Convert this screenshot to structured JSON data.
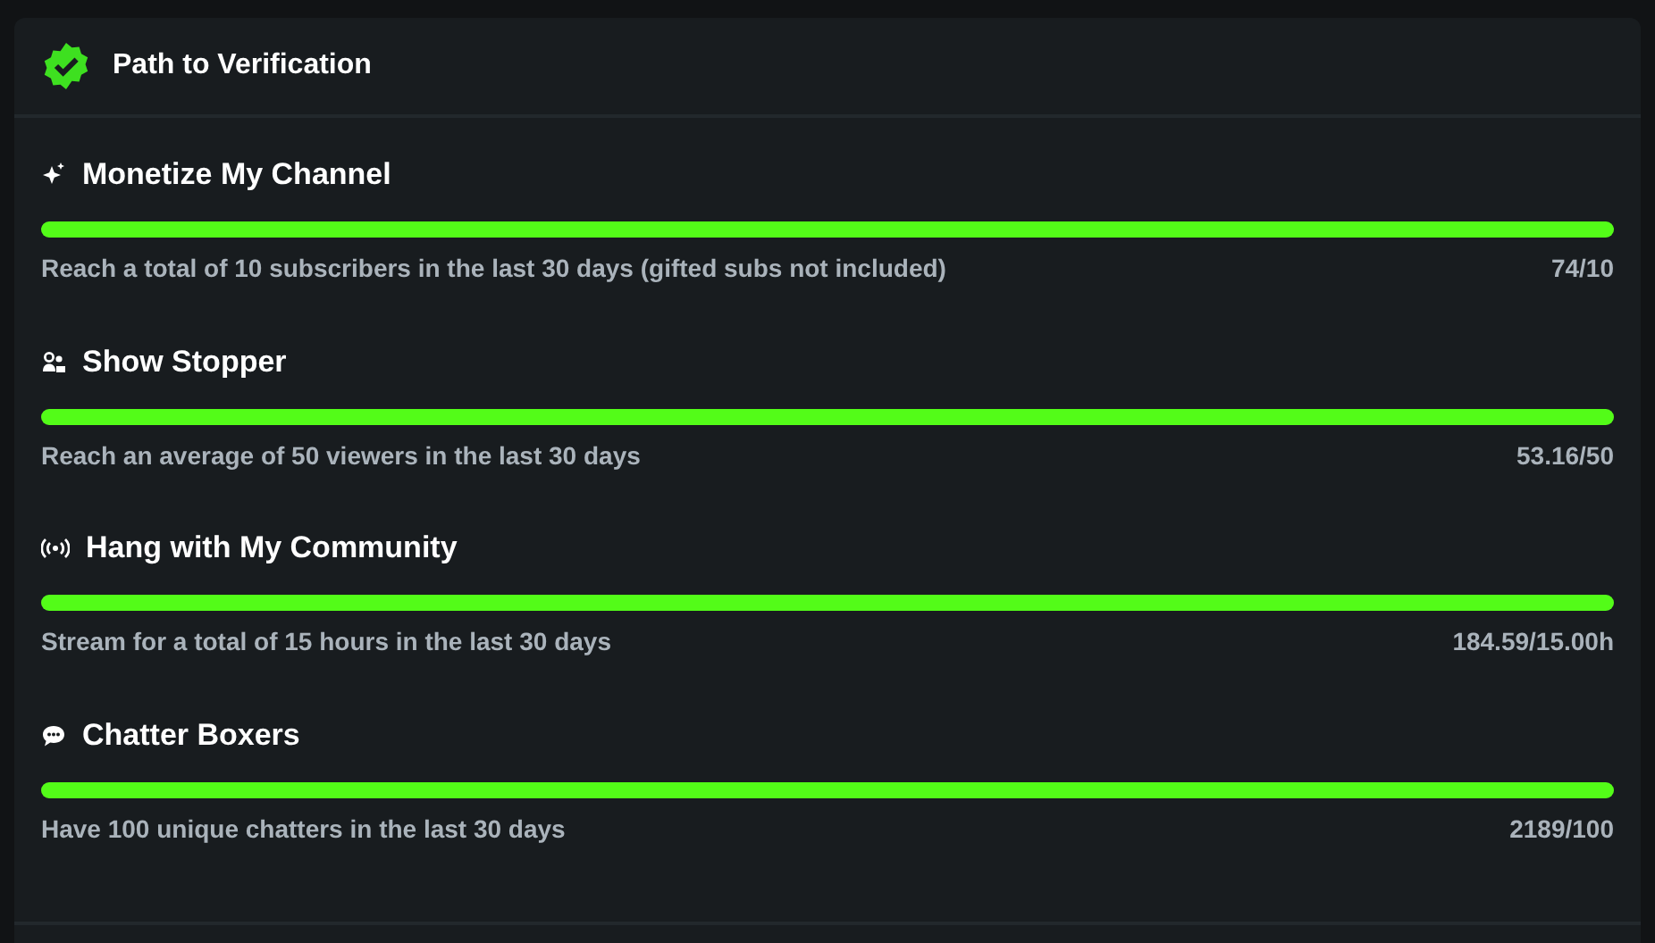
{
  "header": {
    "title": "Path to Verification"
  },
  "goals": [
    {
      "kind": "sparkle",
      "title": "Monetize My Channel",
      "level": 1,
      "description": "Reach a total of 10 subscribers in the last 30 days (gifted subs not included)",
      "progress": "74/10"
    },
    {
      "kind": "people",
      "title": "Show Stopper",
      "level": 1,
      "description": "Reach an average of 50 viewers in the last 30 days",
      "progress": "53.16/50"
    },
    {
      "kind": "broadcast",
      "title": "Hang with My Community",
      "level": 1,
      "description": "Stream for a total of 15 hours in the last 30 days",
      "progress": "184.59/15.00h"
    },
    {
      "kind": "chat",
      "title": "Chatter Boxers",
      "level": 1,
      "description": "Have 100 unique chatters in the last 30 days",
      "progress": "2189/100"
    }
  ]
}
